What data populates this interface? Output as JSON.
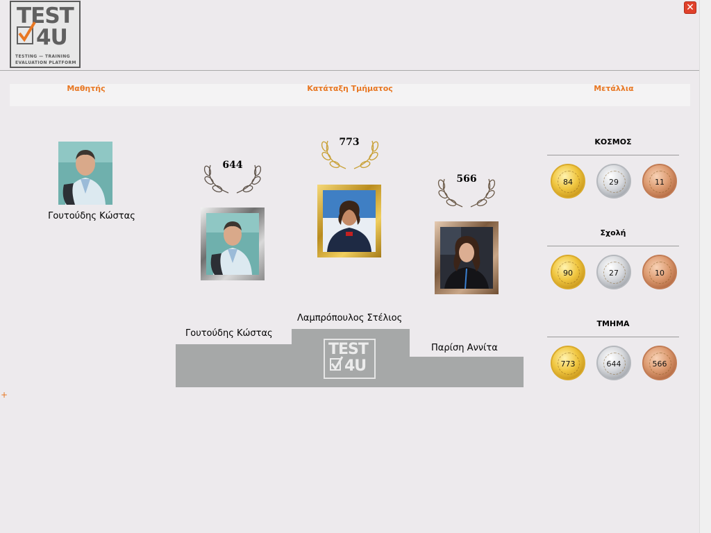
{
  "header": {
    "logo": {
      "line1": "TEST",
      "line2": "4U",
      "sub1": "TESTING — TRAINING",
      "sub2": "EVALUATION PLATFORM"
    },
    "close_label": "✕"
  },
  "tabs": [
    {
      "label": "Μαθητής"
    },
    {
      "label": "Κατάταξη Τμήματος"
    },
    {
      "label": "Μετάλλια"
    }
  ],
  "student": {
    "name": "Γουτούδης Κώστας"
  },
  "ranking": {
    "first": {
      "name": "Λαμπρόπουλος Στέλιος",
      "score": "773"
    },
    "second": {
      "name": "Γουτούδης Κώστας",
      "score": "644"
    },
    "third": {
      "name": "Παρίση Αννίτα",
      "score": "566"
    },
    "podium_logo": {
      "line1": "TEST",
      "line2": "4U"
    }
  },
  "medals": [
    {
      "title": "ΚΟΣΜΟΣ",
      "gold": "84",
      "silver": "29",
      "bronze": "11"
    },
    {
      "title": "Σχολή",
      "gold": "90",
      "silver": "27",
      "bronze": "10"
    },
    {
      "title": "ΤΜΗΜΑ",
      "gold": "773",
      "silver": "644",
      "bronze": "566"
    }
  ],
  "plus_marker": "+",
  "colors": {
    "accent": "#e87722",
    "gold": "#e7b93a",
    "silver": "#c3c5c9",
    "bronze": "#c98560",
    "podium": "#a6a8a8"
  }
}
